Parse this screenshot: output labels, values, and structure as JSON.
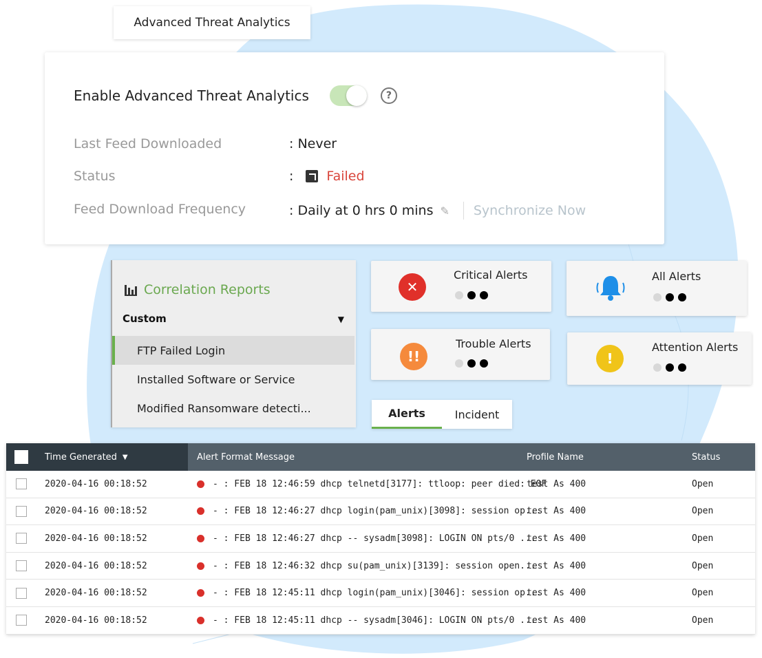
{
  "app": {
    "tab_title": "Advanced Threat Analytics"
  },
  "settings": {
    "enable_label": "Enable Advanced Threat Analytics",
    "enabled": true,
    "help_glyph": "?",
    "last_feed_label": "Last Feed Downloaded",
    "last_feed_value": ": Never",
    "status_label": "Status",
    "status_prefix": ":",
    "status_value": "Failed",
    "frequency_label": "Feed Download Frequency",
    "frequency_value": ": Daily at 0 hrs 0 mins",
    "sync_label": "Synchronize Now"
  },
  "correlation": {
    "title": "Correlation Reports",
    "group": "Custom",
    "items": [
      "FTP Failed Login",
      "Installed Software or Service",
      "Modified Ransomware detecti..."
    ]
  },
  "alert_cards": {
    "critical": {
      "label": "Critical Alerts",
      "icon": "x-circle-icon",
      "color": "#e0302a",
      "glyph": "✕"
    },
    "all": {
      "label": "All Alerts",
      "icon": "bell-icon",
      "color": "#1e8fe8"
    },
    "trouble": {
      "label": "Trouble Alerts",
      "icon": "double-exclamation-icon",
      "color": "#f58a3c",
      "glyph": "!!"
    },
    "attention": {
      "label": "Attention Alerts",
      "icon": "exclamation-icon",
      "color": "#f0c419",
      "glyph": "!"
    }
  },
  "sub_tabs": {
    "alerts": "Alerts",
    "incident": "Incident"
  },
  "table": {
    "columns": {
      "time": "Time Generated",
      "message": "Alert Format Message",
      "profile": "Profile Name",
      "status": "Status"
    },
    "sort_glyph": "▼",
    "rows": [
      {
        "time": "2020-04-16 00:18:52",
        "message": "- : FEB 18 12:46:59 dhcp telnetd[3177]: ttloop: peer died: EOF",
        "profile": "test As 400",
        "status": "Open"
      },
      {
        "time": "2020-04-16 00:18:52",
        "message": "- : FEB 18 12:46:27 dhcp login(pam_unix)[3098]: session op...",
        "profile": "test As 400",
        "status": "Open"
      },
      {
        "time": "2020-04-16 00:18:52",
        "message": "- : FEB 18 12:46:27 dhcp -- sysadm[3098]: LOGIN ON pts/0 ...",
        "profile": "test As 400",
        "status": "Open"
      },
      {
        "time": "2020-04-16 00:18:52",
        "message": "- : FEB 18 12:46:32 dhcp su(pam_unix)[3139]: session open...",
        "profile": "test As 400",
        "status": "Open"
      },
      {
        "time": "2020-04-16 00:18:52",
        "message": "- : FEB 18 12:45:11 dhcp login(pam_unix)[3046]: session op...",
        "profile": "test As 400",
        "status": "Open"
      },
      {
        "time": "2020-04-16 00:18:52",
        "message": "- : FEB 18 12:45:11 dhcp -- sysadm[3046]: LOGIN ON pts/0 ...",
        "profile": "test As 400",
        "status": "Open"
      }
    ]
  },
  "colors": {
    "accent_green": "#6ab04c",
    "failed_red": "#d9453b",
    "table_header": "#53606a",
    "background_blob": "#cfe8fb"
  }
}
